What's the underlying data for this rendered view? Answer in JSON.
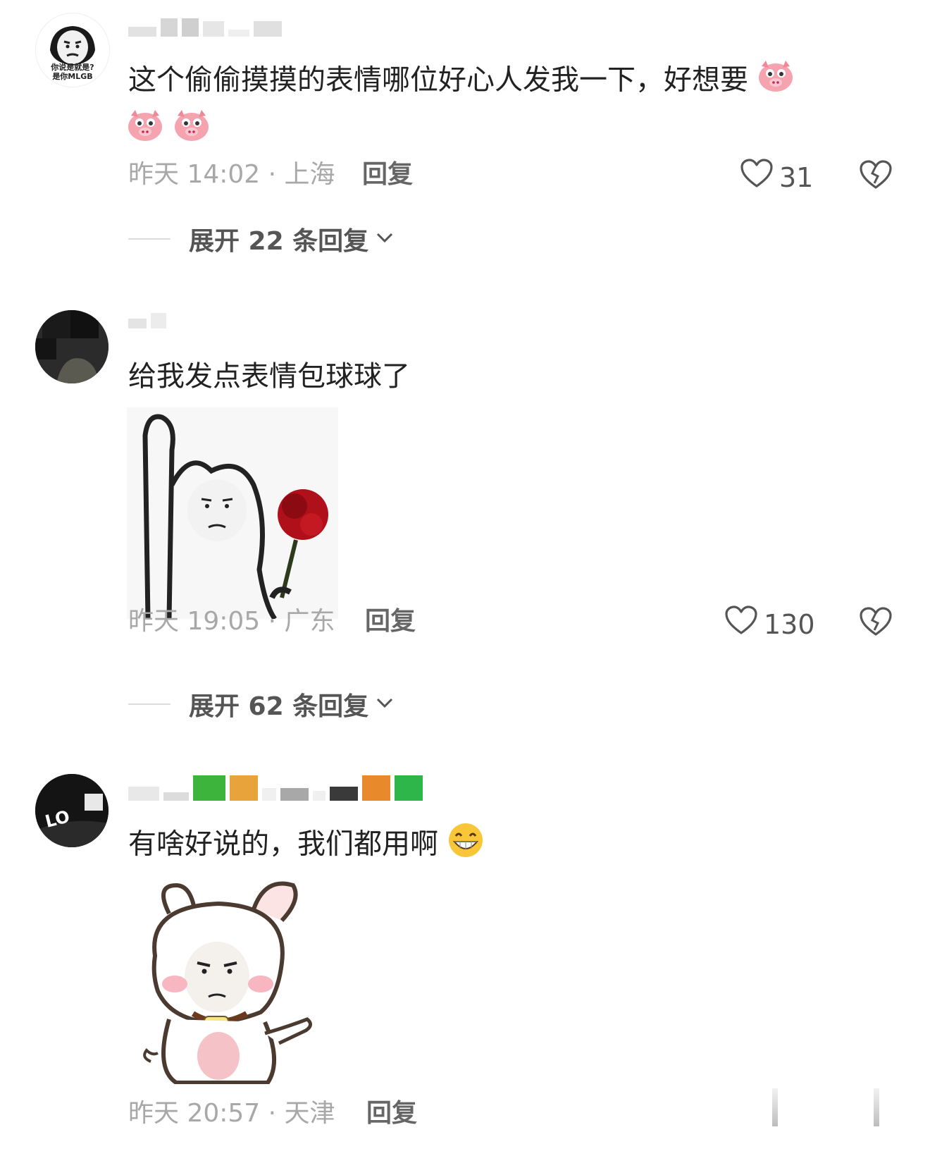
{
  "comments": [
    {
      "text": "这个偷偷摸摸的表情哪位好心人发我一下，好想要",
      "time": "昨天 14:02",
      "location": "· 上海",
      "reply_label": "回复",
      "likes": "31",
      "expand_label": "展开 22 条回复",
      "avatar_caption_1": "你说是就是?",
      "avatar_caption_2": "是你MLGB"
    },
    {
      "text": "给我发点表情包球球了",
      "time": "昨天 19:05",
      "location": "· 广东",
      "reply_label": "回复",
      "likes": "130",
      "expand_label": "展开 62 条回复"
    },
    {
      "text": "有啥好说的，我们都用啊",
      "time": "昨天 20:57",
      "location": "· 天津",
      "reply_label": "回复",
      "avatar_caption": "LO"
    }
  ],
  "colors": {
    "meta": "#a8a8a8",
    "text": "#222222",
    "pig": "#f5a3ae",
    "rose": "#b0101a"
  },
  "icons": [
    "heart-icon",
    "broken-heart-icon",
    "chevron-down-icon",
    "pig-emoji",
    "grin-emoji"
  ]
}
